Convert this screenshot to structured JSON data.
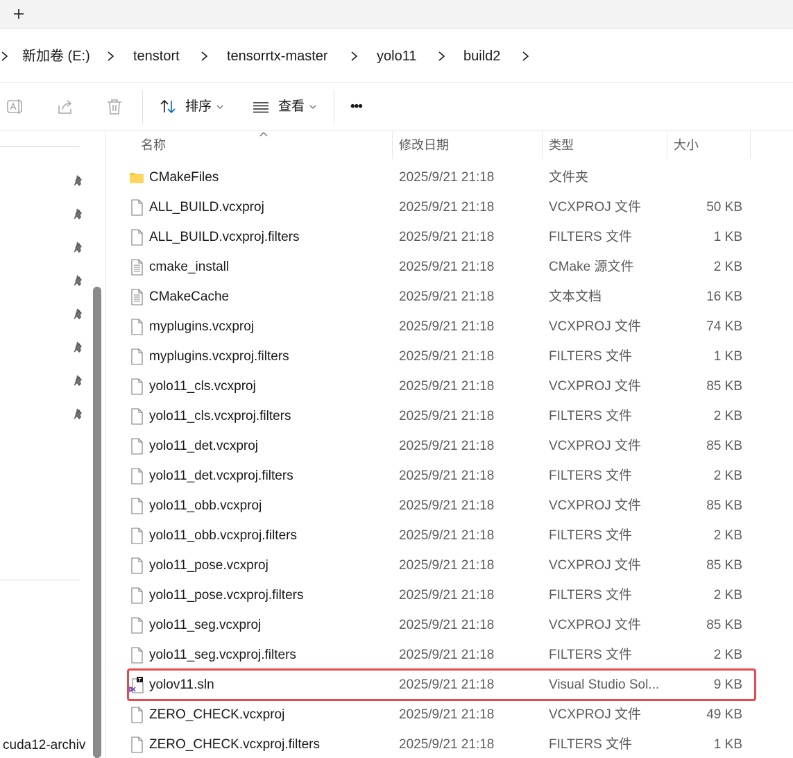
{
  "tabbar": {
    "new_tab_symbol": "+"
  },
  "breadcrumb": [
    "新加卷 (E:)",
    "tenstort",
    "tensorrtx-master",
    "yolo11",
    "build2"
  ],
  "toolbar": {
    "sort_label": "排序",
    "view_label": "查看",
    "more_label": "•••",
    "icons": [
      "rename-icon",
      "share-icon",
      "delete-icon",
      "sort-icon",
      "view-icon",
      "more-icon"
    ]
  },
  "nav": {
    "bottom_item_label": "cuda12-archiv"
  },
  "columns": {
    "name": "名称",
    "date": "修改日期",
    "type": "类型",
    "size": "大小"
  },
  "files": [
    {
      "name": "CMakeFiles",
      "date": "2025/9/21 21:18",
      "type": "文件夹",
      "size": "",
      "icon": "folder"
    },
    {
      "name": "ALL_BUILD.vcxproj",
      "date": "2025/9/21 21:18",
      "type": "VCXPROJ 文件",
      "size": "50 KB",
      "icon": "file"
    },
    {
      "name": "ALL_BUILD.vcxproj.filters",
      "date": "2025/9/21 21:18",
      "type": "FILTERS 文件",
      "size": "1 KB",
      "icon": "file"
    },
    {
      "name": "cmake_install",
      "date": "2025/9/21 21:18",
      "type": "CMake 源文件",
      "size": "2 KB",
      "icon": "text"
    },
    {
      "name": "CMakeCache",
      "date": "2025/9/21 21:18",
      "type": "文本文档",
      "size": "16 KB",
      "icon": "text"
    },
    {
      "name": "myplugins.vcxproj",
      "date": "2025/9/21 21:18",
      "type": "VCXPROJ 文件",
      "size": "74 KB",
      "icon": "file"
    },
    {
      "name": "myplugins.vcxproj.filters",
      "date": "2025/9/21 21:18",
      "type": "FILTERS 文件",
      "size": "1 KB",
      "icon": "file"
    },
    {
      "name": "yolo11_cls.vcxproj",
      "date": "2025/9/21 21:18",
      "type": "VCXPROJ 文件",
      "size": "85 KB",
      "icon": "file"
    },
    {
      "name": "yolo11_cls.vcxproj.filters",
      "date": "2025/9/21 21:18",
      "type": "FILTERS 文件",
      "size": "2 KB",
      "icon": "file"
    },
    {
      "name": "yolo11_det.vcxproj",
      "date": "2025/9/21 21:18",
      "type": "VCXPROJ 文件",
      "size": "85 KB",
      "icon": "file"
    },
    {
      "name": "yolo11_det.vcxproj.filters",
      "date": "2025/9/21 21:18",
      "type": "FILTERS 文件",
      "size": "2 KB",
      "icon": "file"
    },
    {
      "name": "yolo11_obb.vcxproj",
      "date": "2025/9/21 21:18",
      "type": "VCXPROJ 文件",
      "size": "85 KB",
      "icon": "file"
    },
    {
      "name": "yolo11_obb.vcxproj.filters",
      "date": "2025/9/21 21:18",
      "type": "FILTERS 文件",
      "size": "2 KB",
      "icon": "file"
    },
    {
      "name": "yolo11_pose.vcxproj",
      "date": "2025/9/21 21:18",
      "type": "VCXPROJ 文件",
      "size": "85 KB",
      "icon": "file"
    },
    {
      "name": "yolo11_pose.vcxproj.filters",
      "date": "2025/9/21 21:18",
      "type": "FILTERS 文件",
      "size": "2 KB",
      "icon": "file"
    },
    {
      "name": "yolo11_seg.vcxproj",
      "date": "2025/9/21 21:18",
      "type": "VCXPROJ 文件",
      "size": "85 KB",
      "icon": "file"
    },
    {
      "name": "yolo11_seg.vcxproj.filters",
      "date": "2025/9/21 21:18",
      "type": "FILTERS 文件",
      "size": "2 KB",
      "icon": "file"
    },
    {
      "name": "yolov11.sln",
      "date": "2025/9/21 21:18",
      "type": "Visual Studio Sol...",
      "size": "9 KB",
      "icon": "sln",
      "highlighted": true
    },
    {
      "name": "ZERO_CHECK.vcxproj",
      "date": "2025/9/21 21:18",
      "type": "VCXPROJ 文件",
      "size": "49 KB",
      "icon": "file"
    },
    {
      "name": "ZERO_CHECK.vcxproj.filters",
      "date": "2025/9/21 21:18",
      "type": "FILTERS 文件",
      "size": "1 KB",
      "icon": "file"
    }
  ],
  "colors": {
    "highlight_border": "#e8484e",
    "folder": "#f7c948",
    "accent": "#0067c0"
  }
}
